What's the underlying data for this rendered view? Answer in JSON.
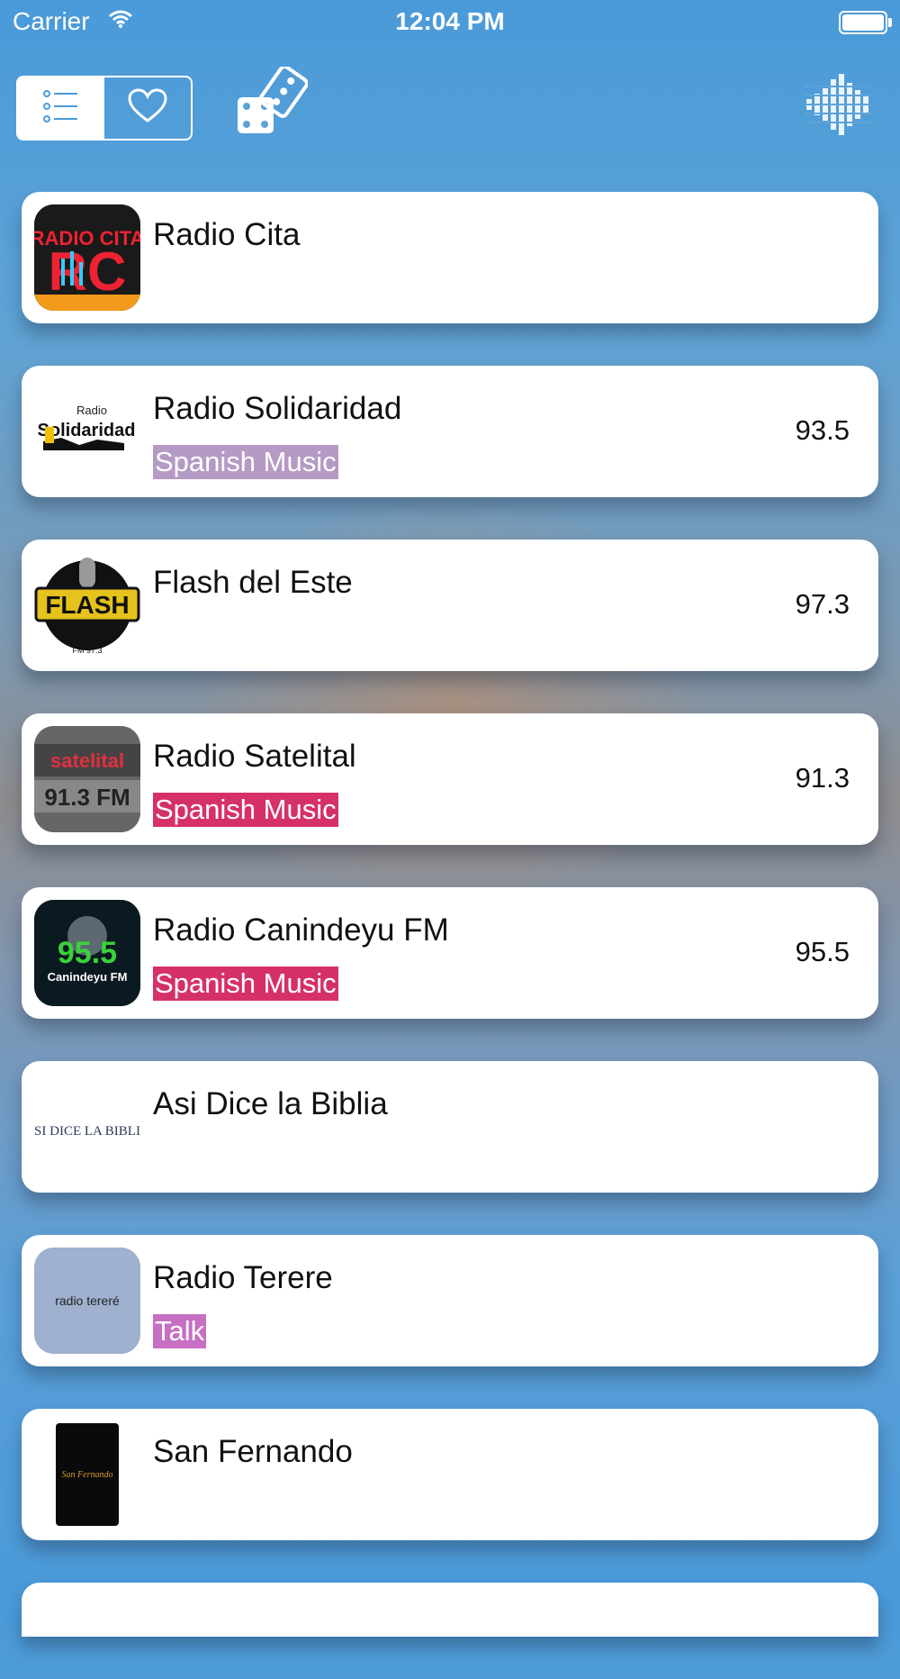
{
  "status_bar": {
    "carrier": "Carrier",
    "time": "12:04 PM"
  },
  "toolbar": {
    "segments": [
      "list-icon",
      "heart-icon"
    ],
    "active_segment": "list",
    "random_icon": "dice-icon",
    "visualizer_icon": "sound-wave-icon"
  },
  "colors": {
    "background_top": "#4a9ad9",
    "genre_spanish_music": "#d6306b",
    "genre_spanish_music_faded": "#b49ac4",
    "genre_talk": "#c66fc3"
  },
  "stations": [
    {
      "name": "Radio Cita",
      "genre": "",
      "freq": "",
      "logo_text": "RADIO CITA"
    },
    {
      "name": "Radio Solidaridad",
      "genre": "Spanish Music",
      "freq": "93.5",
      "logo_text": "Solidaridad"
    },
    {
      "name": "Flash del Este",
      "genre": "",
      "freq": "97.3",
      "logo_text": "FLASH"
    },
    {
      "name": "Radio Satelital",
      "genre": "Spanish Music",
      "freq": "91.3",
      "logo_text": "satelital"
    },
    {
      "name": "Radio Canindeyu FM",
      "genre": "Spanish Music",
      "freq": "95.5",
      "logo_text": "95.5"
    },
    {
      "name": "Asi Dice la Biblia",
      "genre": "",
      "freq": "",
      "logo_text": "ASI DICE LA BIBLIA"
    },
    {
      "name": "Radio Terere",
      "genre": "Talk",
      "freq": "",
      "logo_text": "radio tereré"
    },
    {
      "name": "San Fernando",
      "genre": "",
      "freq": "",
      "logo_text": "San Fernando"
    }
  ]
}
